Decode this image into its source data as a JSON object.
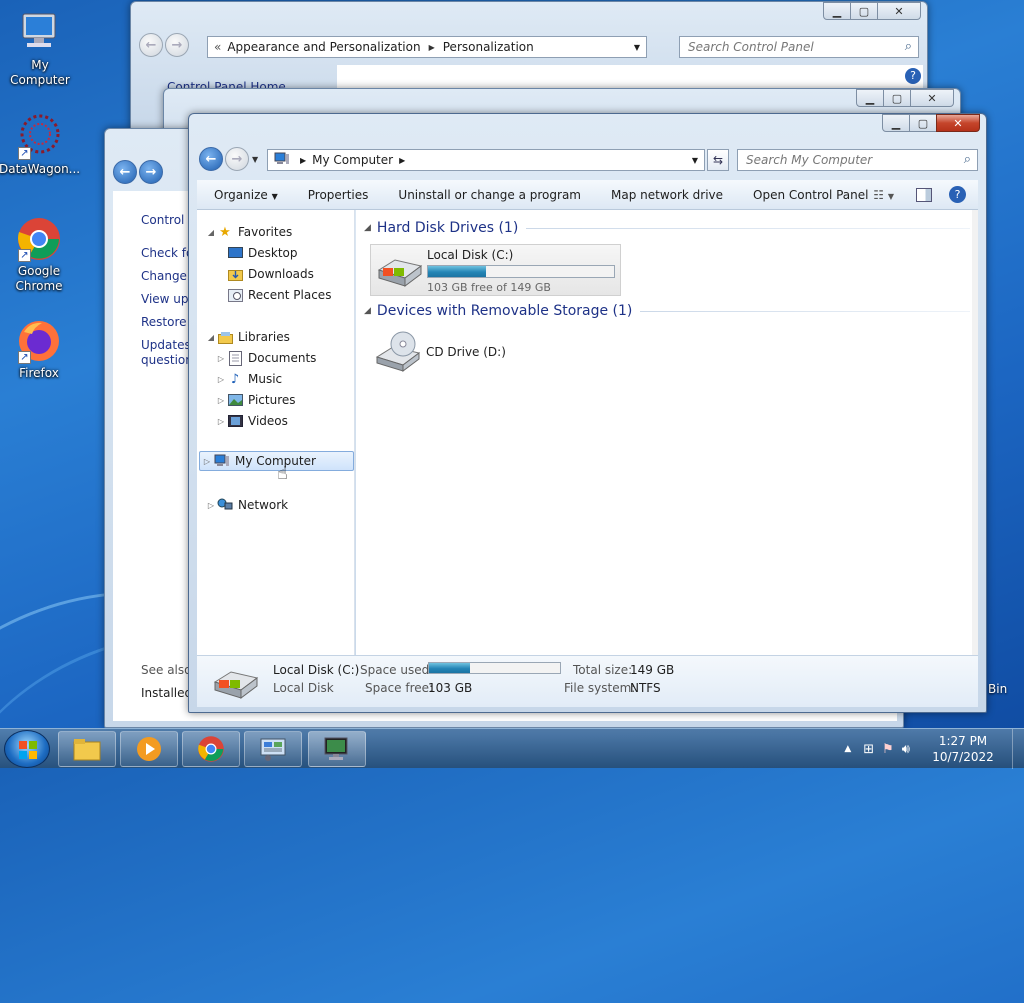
{
  "desktop": {
    "icons": [
      {
        "label": "My Computer"
      },
      {
        "label": "DataWagon..."
      },
      {
        "label": "Google Chrome"
      },
      {
        "label": "Firefox"
      }
    ],
    "recycle_bin_fragment": "Bin"
  },
  "personalization_window": {
    "breadcrumb": [
      "Appearance and Personalization",
      "Personalization"
    ],
    "search_placeholder": "Search Control Panel",
    "left_link": "Control Panel Home"
  },
  "update_window": {
    "sidebar_links": [
      "Control P",
      "Check fo",
      "Change s",
      "View upd",
      "Restore h",
      "Updates:",
      "question"
    ],
    "see_also": "See also",
    "installed": "Installed"
  },
  "main_window": {
    "address": "My Computer",
    "search_placeholder": "Search My Computer",
    "toolbar": {
      "organize": "Organize",
      "properties": "Properties",
      "uninstall": "Uninstall or change a program",
      "map_drive": "Map network drive",
      "open_cp": "Open Control Panel"
    },
    "nav": {
      "favorites": "Favorites",
      "desktop": "Desktop",
      "downloads": "Downloads",
      "recent": "Recent Places",
      "libraries": "Libraries",
      "documents": "Documents",
      "music": "Music",
      "pictures": "Pictures",
      "videos": "Videos",
      "computer": "My Computer",
      "network": "Network"
    },
    "groups": {
      "hdd": "Hard Disk Drives (1)",
      "removable": "Devices with Removable Storage (1)"
    },
    "local_disk": {
      "name": "Local Disk (C:)",
      "free_text": "103 GB free of 149 GB",
      "used_fraction": 0.31
    },
    "cd_drive": {
      "name": "CD Drive (D:)"
    },
    "details": {
      "name": "Local Disk (C:)",
      "type": "Local Disk",
      "space_used_label": "Space used:",
      "space_free_label": "Space free:",
      "space_free": "103 GB",
      "total_size_label": "Total size:",
      "total_size": "149 GB",
      "fs_label": "File system:",
      "fs": "NTFS"
    }
  },
  "taskbar": {
    "time": "1:27 PM",
    "date": "10/7/2022"
  },
  "colors": {
    "accent": "#1e3287",
    "progress": "#2485b6"
  }
}
